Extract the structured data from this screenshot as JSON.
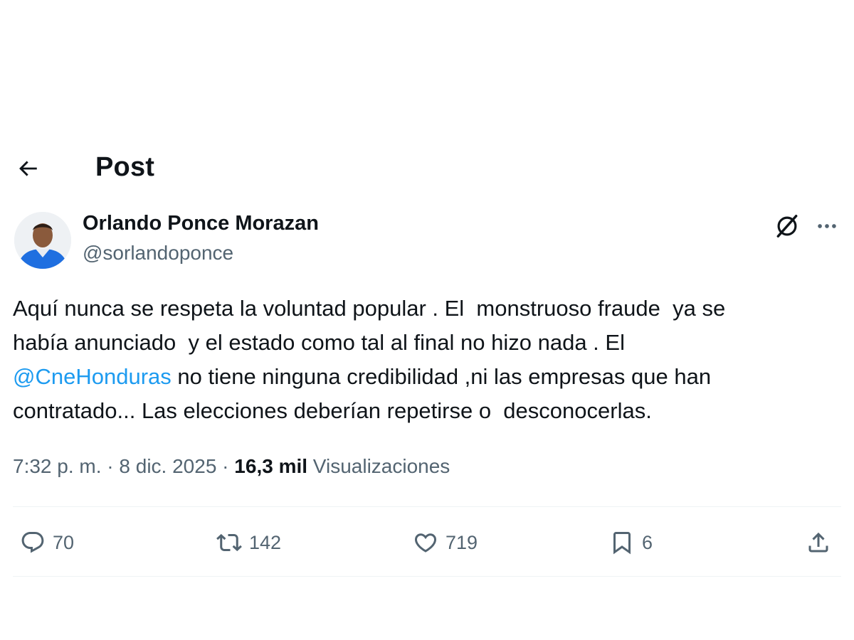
{
  "header": {
    "title": "Post"
  },
  "author": {
    "display_name": "Orlando Ponce Morazan",
    "handle": "@sorlandoponce"
  },
  "tweet": {
    "lines": [
      {
        "text": "Aquí nunca se respeta la voluntad popular . El  monstruoso fraude  ya se"
      },
      {
        "text": "había anunciado  y el estado como tal al final no hizo nada . El"
      },
      {
        "mention": "@CneHonduras",
        "text": " no tiene ninguna credibilidad ,ni las empresas que han"
      },
      {
        "text": "contratado... Las elecciones deberían repetirse o  desconocerlas."
      }
    ]
  },
  "meta": {
    "time": "7:32 p. m.",
    "separator": " · ",
    "date": "8 dic. 2025",
    "views_count": "16,3 mil",
    "views_label": " Visualizaciones"
  },
  "actions": {
    "reply": "70",
    "retweet": "142",
    "like": "719",
    "bookmark": "6"
  },
  "colors": {
    "text": "#0f1419",
    "secondary": "#536471",
    "link": "#1d9bf0",
    "divider": "#eff3f4"
  },
  "icons": [
    "back-arrow-icon",
    "grok-icon",
    "more-icon",
    "reply-icon",
    "retweet-icon",
    "like-icon",
    "bookmark-icon",
    "share-icon"
  ]
}
